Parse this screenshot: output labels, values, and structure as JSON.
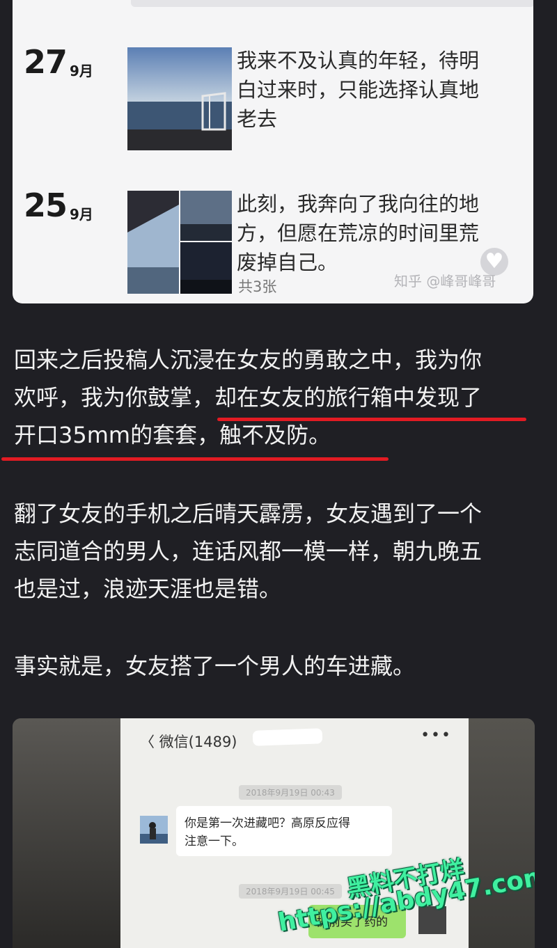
{
  "moments": [
    {
      "day": "27",
      "month": "9月",
      "text_lines": [
        "我来不及认真的年轻，待明",
        "白过来时，只能选择认真地",
        "老去"
      ]
    },
    {
      "day": "25",
      "month": "9月",
      "text_lines": [
        "此刻，我奔向了我向往的地",
        "方，但愿在荒凉的时间里荒",
        "废掉自己。"
      ],
      "photo_count": "共3张"
    }
  ],
  "card_watermark": "知乎 @峰哥峰哥",
  "paragraphs": {
    "p1": [
      "回来之后投稿人沉浸在女友的勇敢之中，我为你",
      "欢呼，我为你鼓掌，却在女友的旅行箱中发现了",
      "开口35mm的套套，触不及防。"
    ],
    "p2": [
      "翻了女友的手机之后晴天霹雳，女友遇到了一个",
      "志同道合的男人，连话风都一模一样，朝九晚五",
      "也是过，浪迹天涯也是错。"
    ],
    "p3": [
      "事实就是，女友搭了一个男人的车进藏。"
    ]
  },
  "highlight_color": "#e21b23",
  "chat": {
    "header": "〈 微信(1489)",
    "menu": "•••",
    "timestamp1": "2018年9月19日 00:43",
    "incoming": [
      "你是第一次进藏吧？高原反应得",
      "注意一下。"
    ],
    "timestamp2": "2018年9月19日 00:45",
    "outgoing": "提前买了药的"
  },
  "site_watermark": {
    "line1": "黑料不打烊",
    "line2": "https://abdy47.com",
    "color": "#40f0a0"
  }
}
